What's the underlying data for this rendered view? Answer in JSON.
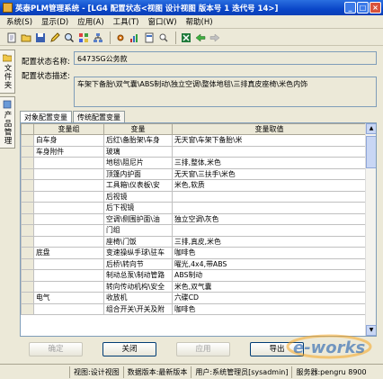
{
  "window": {
    "title": "英泰PLM管理系统 - [LG4 配置状态<视图 设计视图 版本号 1 迭代号 14>]"
  },
  "menubar": [
    {
      "label": "系统(S)"
    },
    {
      "label": "显示(D)"
    },
    {
      "label": "应用(A)"
    },
    {
      "label": "工具(T)"
    },
    {
      "label": "窗口(W)"
    },
    {
      "label": "帮助(H)"
    }
  ],
  "sidebar": {
    "tabs": [
      {
        "label": "文件夹"
      },
      {
        "label": "产品管理"
      }
    ]
  },
  "form": {
    "name_label": "配置状态名称:",
    "name_value": "6473SG公务款",
    "desc_label": "配置状态描述:",
    "desc_value": "车架下备胎\\双气囊\\ABS制动\\独立空调\\整体地毯\\三排真皮座椅\\米色内饰"
  },
  "tabs": [
    {
      "label": "对象配置变量",
      "active": true
    },
    {
      "label": "传统配置变量",
      "active": false
    }
  ],
  "table": {
    "headers": [
      "",
      "变量组",
      "变量",
      "变量取值"
    ],
    "rows": [
      [
        "",
        "白车身",
        "后红\\备胎架\\车身",
        "无天窗\\车架下备胎\\米"
      ],
      [
        "",
        "车身附件",
        "玻璃",
        ""
      ],
      [
        "",
        "",
        "地毯\\阻尼片",
        "三排,整体,米色"
      ],
      [
        "",
        "",
        "顶篷内护面",
        "无天窗\\三扶手\\米色"
      ],
      [
        "",
        "",
        "工具箱\\仪表板\\安",
        "米色,软质"
      ],
      [
        "",
        "",
        "后视镜",
        ""
      ],
      [
        "",
        "",
        "后下视镜",
        ""
      ],
      [
        "",
        "",
        "空调\\侧围护面\\油",
        "独立空调\\灰色"
      ],
      [
        "",
        "",
        "门组",
        ""
      ],
      [
        "",
        "",
        "座椅\\门饭",
        "三排,真皮,米色"
      ],
      [
        "",
        "底盘",
        "变速操纵手球\\驻车",
        "咖啡色"
      ],
      [
        "",
        "",
        "后桥\\转向节",
        "曜光,4x4,带ABS"
      ],
      [
        "",
        "",
        "制动总泵\\制动管路",
        "ABS制动"
      ],
      [
        "",
        "",
        "转向传动机构\\安全",
        "米色,双气囊"
      ],
      [
        "",
        "电气",
        "收放机",
        "六碟CD"
      ],
      [
        "",
        "",
        "组合开关\\开关及附",
        "咖啡色"
      ]
    ]
  },
  "buttons": {
    "ok": "确定",
    "close": "关闭",
    "apply": "应用",
    "export": "导出"
  },
  "statusbar": {
    "view": "视图:设计视图",
    "version": "数据版本:最新版本",
    "user": "用户:系统管理员[sysadmin]",
    "server": "服务器:pengru 8900"
  },
  "watermark": {
    "text": "e-works"
  }
}
